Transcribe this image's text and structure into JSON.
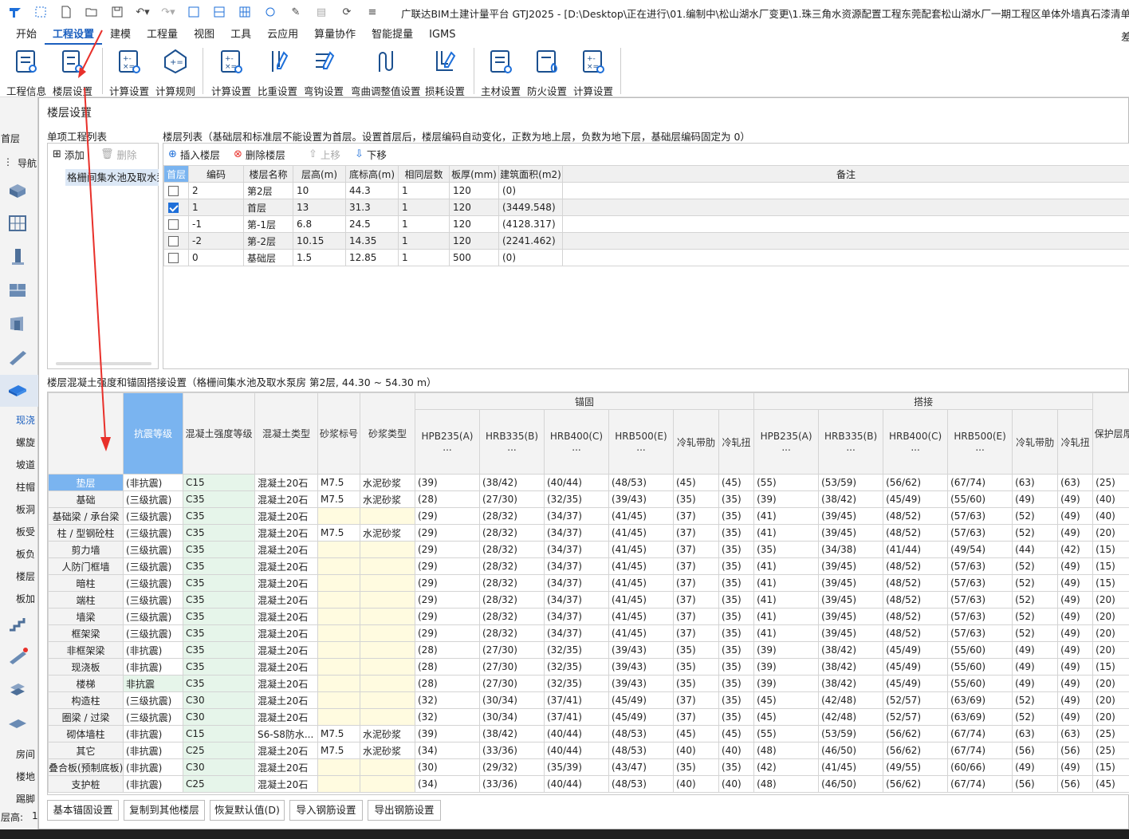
{
  "app": {
    "title": "广联达BIM土建计量平台 GTJ2025 - [D:\\Desktop\\正在进行\\01.编制中\\松山湖水厂变更\\1.珠三角水资源配置工程东莞配套松山湖水厂一期工程区单体外墙真石漆清单错漏量"
  },
  "menu": {
    "tabs": [
      "开始",
      "工程设置",
      "建模",
      "工程量",
      "视图",
      "工具",
      "云应用",
      "算量协作",
      "智能提量",
      "IGMS"
    ],
    "right_glyph": "差"
  },
  "ribbon": {
    "buttons": [
      "工程信息",
      "楼层设置",
      "计算设置",
      "计算规则",
      "计算设置",
      "比重设置",
      "弯钩设置",
      "弯曲调整值设置",
      "损耗设置",
      "主材设置",
      "防火设置",
      "计算设置"
    ]
  },
  "sidebar": {
    "floor": "首层",
    "nav": "导航",
    "items": [
      "现浇",
      "螺旋",
      "坡道",
      "柱帽",
      "板洞",
      "板受",
      "板负",
      "楼层",
      "板加"
    ],
    "items2": [
      "房间",
      "楼地",
      "踢脚"
    ],
    "bottom": "层高:",
    "bottom_value": "1"
  },
  "dialog": {
    "title": "楼层设置",
    "project_list_label": "单项工程列表",
    "add": "添加",
    "delete": "删除",
    "project_item": "格栅间集水池及取水泵",
    "floor_list_label": "楼层列表（基础层和标准层不能设置为首层。设置首层后，楼层编码自动变化，正数为地上层，负数为地下层，基础层编码固定为 0）",
    "insert_floor": "插入楼层",
    "delete_floor": "删除楼层",
    "move_up": "上移",
    "move_down": "下移"
  },
  "floors": {
    "headers": [
      "首层",
      "编码",
      "楼层名称",
      "层高(m)",
      "底标高(m)",
      "相同层数",
      "板厚(mm)",
      "建筑面积(m2)",
      "备注"
    ],
    "rows": [
      {
        "code": "2",
        "name": "第2层",
        "height": "10",
        "base": "44.3",
        "same": "1",
        "thick": "120",
        "area": "(0)",
        "checked": false
      },
      {
        "code": "1",
        "name": "首层",
        "height": "13",
        "base": "31.3",
        "same": "1",
        "thick": "120",
        "area": "(3449.548)",
        "checked": true
      },
      {
        "code": "-1",
        "name": "第-1层",
        "height": "6.8",
        "base": "24.5",
        "same": "1",
        "thick": "120",
        "area": "(4128.317)",
        "checked": false
      },
      {
        "code": "-2",
        "name": "第-2层",
        "height": "10.15",
        "base": "14.35",
        "same": "1",
        "thick": "120",
        "area": "(2241.462)",
        "checked": false
      },
      {
        "code": "0",
        "name": "基础层",
        "height": "1.5",
        "base": "12.85",
        "same": "1",
        "thick": "500",
        "area": "(0)",
        "checked": false
      }
    ]
  },
  "anchor": {
    "label": "楼层混凝土强度和锚固搭接设置（格栅间集水池及取水泵房  第2层, 44.30 ~ 54.30 m）",
    "group_anchor": "锚固",
    "group_lap": "搭接",
    "headers": [
      "抗震等级",
      "混凝土强度等级",
      "混凝土类型",
      "砂浆标号",
      "砂浆类型",
      "HPB235(A)\n...",
      "HRB335(B)\n...",
      "HRB400(C)\n...",
      "HRB500(E)\n...",
      "冷轧带肋",
      "冷轧扭",
      "HPB235(A)\n...",
      "HRB335(B)\n...",
      "HRB400(C)\n...",
      "HRB500(E)\n...",
      "冷轧带肋",
      "冷轧扭",
      "保护层厚"
    ],
    "rows": [
      [
        "垫层",
        "(非抗震)",
        "C15",
        "混凝土20石",
        "M7.5",
        "水泥砂浆",
        "(39)",
        "(38/42)",
        "(40/44)",
        "(48/53)",
        "(45)",
        "(45)",
        "(55)",
        "(53/59)",
        "(56/62)",
        "(67/74)",
        "(63)",
        "(63)",
        "(25)"
      ],
      [
        "基础",
        "(三级抗震)",
        "C35",
        "混凝土20石",
        "M7.5",
        "水泥砂浆",
        "(28)",
        "(27/30)",
        "(32/35)",
        "(39/43)",
        "(35)",
        "(35)",
        "(39)",
        "(38/42)",
        "(45/49)",
        "(55/60)",
        "(49)",
        "(49)",
        "(40)"
      ],
      [
        "基础梁 / 承台梁",
        "(三级抗震)",
        "C35",
        "混凝土20石",
        "",
        "",
        "(29)",
        "(28/32)",
        "(34/37)",
        "(41/45)",
        "(37)",
        "(35)",
        "(41)",
        "(39/45)",
        "(48/52)",
        "(57/63)",
        "(52)",
        "(49)",
        "(40)"
      ],
      [
        "柱 / 型钢砼柱",
        "(三级抗震)",
        "C35",
        "混凝土20石",
        "M7.5",
        "水泥砂浆",
        "(29)",
        "(28/32)",
        "(34/37)",
        "(41/45)",
        "(37)",
        "(35)",
        "(41)",
        "(39/45)",
        "(48/52)",
        "(57/63)",
        "(52)",
        "(49)",
        "(20)"
      ],
      [
        "剪力墙",
        "(三级抗震)",
        "C35",
        "混凝土20石",
        "",
        "",
        "(29)",
        "(28/32)",
        "(34/37)",
        "(41/45)",
        "(37)",
        "(35)",
        "(35)",
        "(34/38)",
        "(41/44)",
        "(49/54)",
        "(44)",
        "(42)",
        "(15)"
      ],
      [
        "人防门框墙",
        "(三级抗震)",
        "C35",
        "混凝土20石",
        "",
        "",
        "(29)",
        "(28/32)",
        "(34/37)",
        "(41/45)",
        "(37)",
        "(35)",
        "(41)",
        "(39/45)",
        "(48/52)",
        "(57/63)",
        "(52)",
        "(49)",
        "(15)"
      ],
      [
        "暗柱",
        "(三级抗震)",
        "C35",
        "混凝土20石",
        "",
        "",
        "(29)",
        "(28/32)",
        "(34/37)",
        "(41/45)",
        "(37)",
        "(35)",
        "(41)",
        "(39/45)",
        "(48/52)",
        "(57/63)",
        "(52)",
        "(49)",
        "(15)"
      ],
      [
        "端柱",
        "(三级抗震)",
        "C35",
        "混凝土20石",
        "",
        "",
        "(29)",
        "(28/32)",
        "(34/37)",
        "(41/45)",
        "(37)",
        "(35)",
        "(41)",
        "(39/45)",
        "(48/52)",
        "(57/63)",
        "(52)",
        "(49)",
        "(20)"
      ],
      [
        "墙梁",
        "(三级抗震)",
        "C35",
        "混凝土20石",
        "",
        "",
        "(29)",
        "(28/32)",
        "(34/37)",
        "(41/45)",
        "(37)",
        "(35)",
        "(41)",
        "(39/45)",
        "(48/52)",
        "(57/63)",
        "(52)",
        "(49)",
        "(20)"
      ],
      [
        "框架梁",
        "(三级抗震)",
        "C35",
        "混凝土20石",
        "",
        "",
        "(29)",
        "(28/32)",
        "(34/37)",
        "(41/45)",
        "(37)",
        "(35)",
        "(41)",
        "(39/45)",
        "(48/52)",
        "(57/63)",
        "(52)",
        "(49)",
        "(20)"
      ],
      [
        "非框架梁",
        "(非抗震)",
        "C35",
        "混凝土20石",
        "",
        "",
        "(28)",
        "(27/30)",
        "(32/35)",
        "(39/43)",
        "(35)",
        "(35)",
        "(39)",
        "(38/42)",
        "(45/49)",
        "(55/60)",
        "(49)",
        "(49)",
        "(20)"
      ],
      [
        "现浇板",
        "(非抗震)",
        "C35",
        "混凝土20石",
        "",
        "",
        "(28)",
        "(27/30)",
        "(32/35)",
        "(39/43)",
        "(35)",
        "(35)",
        "(39)",
        "(38/42)",
        "(45/49)",
        "(55/60)",
        "(49)",
        "(49)",
        "(15)"
      ],
      [
        "楼梯",
        "非抗震",
        "C35",
        "混凝土20石",
        "",
        "",
        "(28)",
        "(27/30)",
        "(32/35)",
        "(39/43)",
        "(35)",
        "(35)",
        "(39)",
        "(38/42)",
        "(45/49)",
        "(55/60)",
        "(49)",
        "(49)",
        "(20)"
      ],
      [
        "构造柱",
        "(三级抗震)",
        "C30",
        "混凝土20石",
        "",
        "",
        "(32)",
        "(30/34)",
        "(37/41)",
        "(45/49)",
        "(37)",
        "(35)",
        "(45)",
        "(42/48)",
        "(52/57)",
        "(63/69)",
        "(52)",
        "(49)",
        "(20)"
      ],
      [
        "圈梁 / 过梁",
        "(三级抗震)",
        "C30",
        "混凝土20石",
        "",
        "",
        "(32)",
        "(30/34)",
        "(37/41)",
        "(45/49)",
        "(37)",
        "(35)",
        "(45)",
        "(42/48)",
        "(52/57)",
        "(63/69)",
        "(52)",
        "(49)",
        "(20)"
      ],
      [
        "砌体墙柱",
        "(非抗震)",
        "C15",
        "S6-S8防水...",
        "M7.5",
        "水泥砂浆",
        "(39)",
        "(38/42)",
        "(40/44)",
        "(48/53)",
        "(45)",
        "(45)",
        "(55)",
        "(53/59)",
        "(56/62)",
        "(67/74)",
        "(63)",
        "(63)",
        "(25)"
      ],
      [
        "其它",
        "(非抗震)",
        "C25",
        "混凝土20石",
        "M7.5",
        "水泥砂浆",
        "(34)",
        "(33/36)",
        "(40/44)",
        "(48/53)",
        "(40)",
        "(40)",
        "(48)",
        "(46/50)",
        "(56/62)",
        "(67/74)",
        "(56)",
        "(56)",
        "(25)"
      ],
      [
        "叠合板(预制底板)",
        "(非抗震)",
        "C30",
        "混凝土20石",
        "",
        "",
        "(30)",
        "(29/32)",
        "(35/39)",
        "(43/47)",
        "(35)",
        "(35)",
        "(42)",
        "(41/45)",
        "(49/55)",
        "(60/66)",
        "(49)",
        "(49)",
        "(15)"
      ],
      [
        "支护桩",
        "(非抗震)",
        "C25",
        "混凝土20石",
        "",
        "",
        "(34)",
        "(33/36)",
        "(40/44)",
        "(48/53)",
        "(40)",
        "(40)",
        "(48)",
        "(46/50)",
        "(56/62)",
        "(67/74)",
        "(56)",
        "(56)",
        "(45)"
      ]
    ]
  },
  "footer": {
    "buttons": [
      "基本锚固设置",
      "复制到其他楼层",
      "恢复默认值(D)",
      "导入钢筋设置",
      "导出钢筋设置"
    ]
  },
  "colors": {
    "accent": "#1b5fbf",
    "selected_header": "#7ab4f0",
    "green_cell": "#e6f5ea",
    "yellow_cell": "#fffbe0",
    "arrow": "#e8302a"
  }
}
